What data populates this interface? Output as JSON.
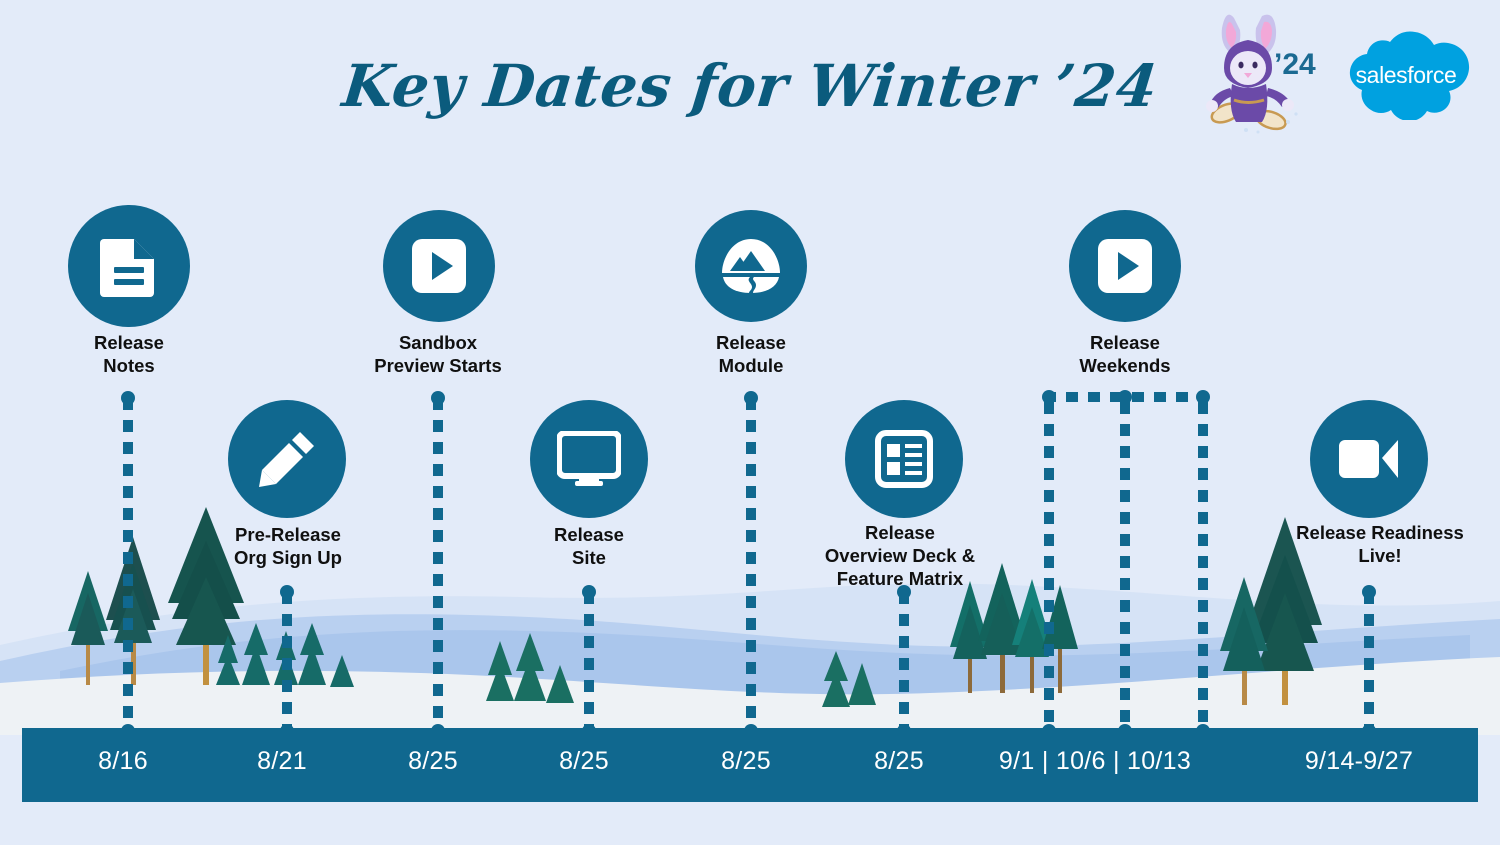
{
  "header": {
    "title": "Key Dates for Winter ’24",
    "mascot_year": "’24",
    "mascot_name": "astro-winter-rabbit-mascot",
    "brand_logo_text": "salesforce",
    "brand_color": "#00a1e0",
    "accent_color": "#10688f",
    "background_color": "#e3ebf9",
    "title_color": "#0b5b7d"
  },
  "timeline": {
    "milestones": [
      {
        "id": "release-notes",
        "label": "Release\nNotes",
        "date": "8/16",
        "icon": "document-icon",
        "row": "top"
      },
      {
        "id": "pre-release-org-sign-up",
        "label": "Pre-Release\nOrg Sign Up",
        "date": "8/21",
        "icon": "pencil-icon",
        "row": "bottom"
      },
      {
        "id": "sandbox-preview-starts",
        "label": "Sandbox\nPreview Starts",
        "date": "8/25",
        "icon": "play-video-icon",
        "row": "top"
      },
      {
        "id": "release-site",
        "label": "Release\nSite",
        "date": "8/25",
        "icon": "monitor-icon",
        "row": "bottom"
      },
      {
        "id": "release-module",
        "label": "Release\nModule",
        "date": "8/25",
        "icon": "trailhead-badge-icon",
        "row": "top"
      },
      {
        "id": "release-overview-deck-feature-matrix",
        "label": "Release\nOverview Deck &\nFeature Matrix",
        "date": "8/25",
        "icon": "article-list-icon",
        "row": "bottom"
      },
      {
        "id": "release-weekends",
        "label": "Release\nWeekends",
        "date": "9/1 | 10/6 | 10/13",
        "icon": "play-video-icon",
        "row": "top"
      },
      {
        "id": "release-readiness-live",
        "label": "Release Readiness\nLive!",
        "date": "9/14-9/27",
        "icon": "video-camera-icon",
        "row": "bottom"
      }
    ]
  }
}
